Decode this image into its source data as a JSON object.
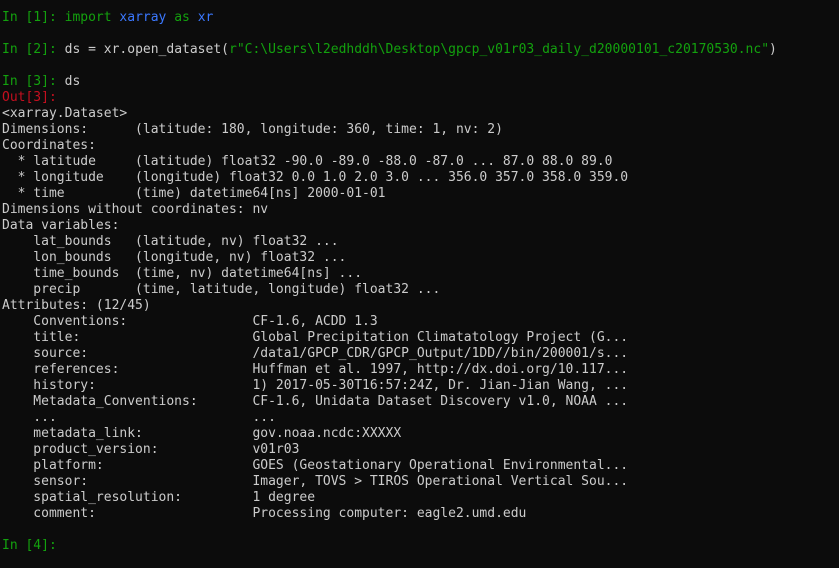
{
  "colors": {
    "background": "#0c0c0c",
    "text": "#cccccc",
    "prompt_in": "#13a10e",
    "prompt_out": "#c50f1f",
    "module": "#3b78ff",
    "string": "#13a10e"
  },
  "cells": {
    "in1": {
      "prompt": "In [1]:",
      "kw_import": "import",
      "module": "xarray",
      "kw_as": "as",
      "alias": "xr"
    },
    "in2": {
      "prompt": "In [2]:",
      "code_pre": "ds = xr.open_dataset(",
      "string": "r\"C:\\Users\\l2edhddh\\Desktop\\gpcp_v01r03_daily_d20000101_c20170530.nc\"",
      "code_post": ")"
    },
    "in3": {
      "prompt": "In [3]:",
      "code": "ds"
    },
    "out3": {
      "prompt": "Out[3]:"
    },
    "in4": {
      "prompt": "In [4]:"
    }
  },
  "output_lines": [
    "<xarray.Dataset>",
    "Dimensions:      (latitude: 180, longitude: 360, time: 1, nv: 2)",
    "Coordinates:",
    "  * latitude     (latitude) float32 -90.0 -89.0 -88.0 -87.0 ... 87.0 88.0 89.0",
    "  * longitude    (longitude) float32 0.0 1.0 2.0 3.0 ... 356.0 357.0 358.0 359.0",
    "  * time         (time) datetime64[ns] 2000-01-01",
    "Dimensions without coordinates: nv",
    "Data variables:",
    "    lat_bounds   (latitude, nv) float32 ...",
    "    lon_bounds   (longitude, nv) float32 ...",
    "    time_bounds  (time, nv) datetime64[ns] ...",
    "    precip       (time, latitude, longitude) float32 ...",
    "Attributes: (12/45)",
    "    Conventions:                CF-1.6, ACDD 1.3",
    "    title:                      Global Precipitation Climatatology Project (G...",
    "    source:                     /data1/GPCP_CDR/GPCP_Output/1DD//bin/200001/s...",
    "    references:                 Huffman et al. 1997, http://dx.doi.org/10.117...",
    "    history:                    1) 2017-05-30T16:57:24Z, Dr. Jian-Jian Wang, ...",
    "    Metadata_Conventions:       CF-1.6, Unidata Dataset Discovery v1.0, NOAA ...",
    "    ...                         ...",
    "    metadata_link:              gov.noaa.ncdc:XXXXX",
    "    product_version:            v01r03",
    "    platform:                   GOES (Geostationary Operational Environmental...",
    "    sensor:                     Imager, TOVS > TIROS Operational Vertical Sou...",
    "    spatial_resolution:         1 degree",
    "    comment:                    Processing computer: eagle2.umd.edu"
  ]
}
